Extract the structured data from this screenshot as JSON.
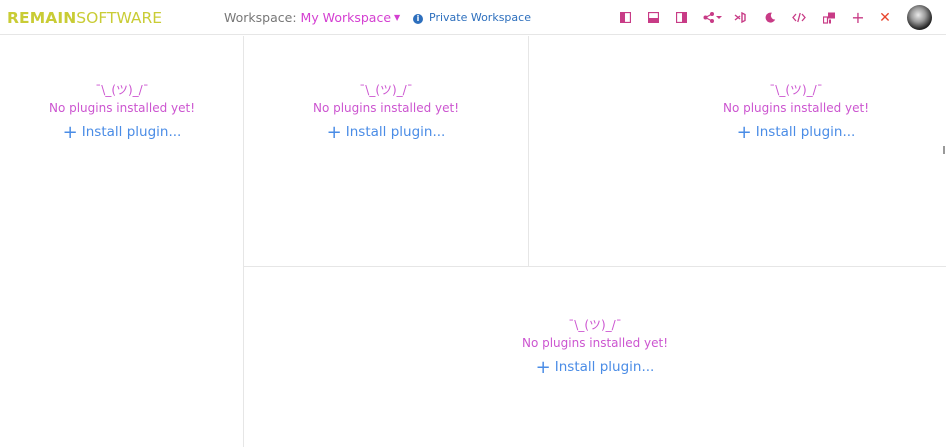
{
  "header": {
    "logo_bold": "REMAIN",
    "logo_light": "SOFTWARE",
    "workspace_label": "Workspace:",
    "workspace_name": "My Workspace",
    "privacy_label": "Private Workspace",
    "toolbar_icons": [
      "toggle-left-panel-icon",
      "toggle-bottom-panel-icon",
      "toggle-right-panel-icon",
      "share-icon",
      "vscode-icon",
      "dark-mode-icon",
      "code-icon",
      "plugins-icon",
      "add-icon",
      "close-icon"
    ]
  },
  "panels": [
    {
      "shrug": "¯\\_(ツ)_/¯",
      "message": "No plugins installed yet!",
      "install_label": "Install plugin..."
    },
    {
      "shrug": "¯\\_(ツ)_/¯",
      "message": "No plugins installed yet!",
      "install_label": "Install plugin..."
    },
    {
      "shrug": "¯\\_(ツ)_/¯",
      "message": "No plugins installed yet!",
      "install_label": "Install plugin..."
    },
    {
      "shrug": "¯\\_(ツ)_/¯",
      "message": "No plugins installed yet!",
      "install_label": "Install plugin..."
    }
  ],
  "colors": {
    "logo": "#c9cc35",
    "accent": "#d43fd1",
    "toolbar": "#c83b86",
    "link": "#4a8ce6",
    "privacy": "#2d6fbd",
    "close": "#e8452c"
  }
}
